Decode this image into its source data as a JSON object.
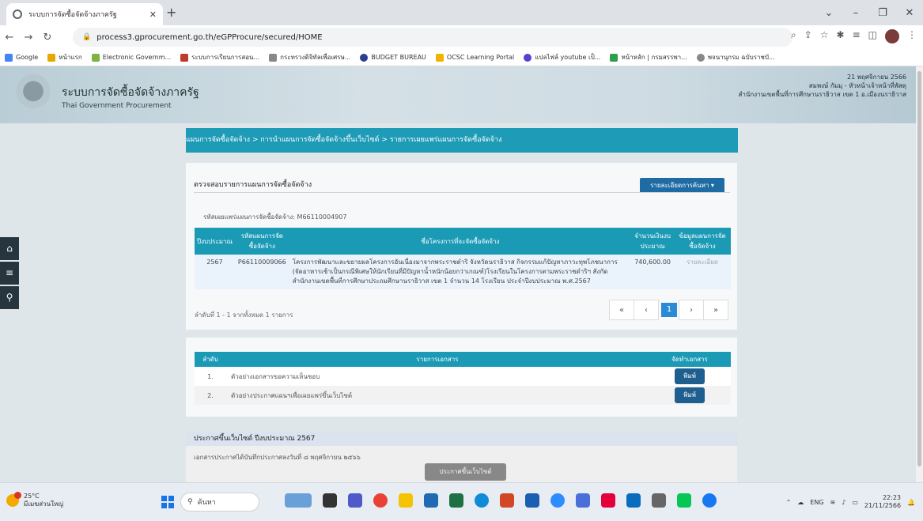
{
  "browser": {
    "tab_title": "ระบบการจัดซื้อจัดจ้างภาครัฐ",
    "url": "process3.gprocurement.go.th/eGPProcure/secured/HOME",
    "bookmarks": [
      "Google",
      "หน้าแรก",
      "Electronic Governm...",
      "ระบบการเรียนการสอน...",
      "กระทรวงดิจิทัลเพื่อเศรษ...",
      "BUDGET BUREAU",
      "OCSC Learning Portal",
      "แปลไฟล์ youtube เป็...",
      "หน้าหลัก | กรมสรรพา...",
      "พจนานุกรม ฉบับราชบั..."
    ]
  },
  "header": {
    "title": "ระบบการจัดซื้อจัดจ้างภาครัฐ",
    "subtitle": "Thai Government Procurement",
    "date": "21 พฤศจิกายน 2566",
    "user": "สมพงษ์ กัมมุ - หัวหน้าเจ้าหน้าที่พัสดุ",
    "org": "สำนักงานเขตพื้นที่การศึกษานราธิวาส เขต 1 อ.เมืองนราธิวาส"
  },
  "breadcrumb": "แผนการจัดซื้อจัดจ้าง > การนำแผนการจัดซื้อจัดจ้างขึ้นเว็บไซต์ > รายการเผยแพร่แผนการจัดซื้อจัดจ้าง",
  "check_panel": {
    "title": "ตรวจสอบรายการแผนการจัดซื้อจัดจ้าง",
    "detail_button": "รายละเอียดการค้นหา ▾",
    "plan_code_label": "รหัสเผยแพร่แผนการจัดซื้อจัดจ้าง: M66110004907",
    "columns": {
      "year": "ปีงบประมาณ",
      "plan_code": "รหัสแผนการจัดซื้อจัดจ้าง",
      "project_name": "ชื่อโครงการที่จะจัดซื้อจัดจ้าง",
      "budget": "จำนวนเงินงบประมาณ",
      "plan_info": "ข้อมูลแผนการจัดซื้อจัดจ้าง"
    },
    "row": {
      "year": "2567",
      "plan_code": "P66110009066",
      "project_name": "โครงการพัฒนาและขยายผลโครงการอันเนื่องมาจากพระราชดำริ จังหวัดนราธิวาส กิจกรรมแก้ปัญหาภาวะทุพโภชนาการ (จัดอาหารเช้าเป็นกรณีพิเศษให้นักเรียนที่มีปัญหาน้ำหนักน้อยกว่าเกณฑ์)โรงเรียนในโครงการตามพระราชดำริฯ สังกัดสำนักงานเขตพื้นที่การศึกษาประถมศึกษานราธิวาส เขต 1 จำนวน 14 โรงเรียน ประจำปีงบประมาณ พ.ศ.2567",
      "budget": "740,600.00",
      "plan_info": "รายละเอียด"
    },
    "order_text": "ลำดับที่ 1 - 1 จากทั้งหมด 1 รายการ",
    "pager": {
      "first": "«",
      "prev": "‹",
      "current": "1",
      "next": "›",
      "last": "»"
    }
  },
  "docs_panel": {
    "columns": {
      "no": "ลำดับ",
      "doc": "รายการเอกสาร",
      "action": "จัดทำเอกสาร"
    },
    "rows": [
      {
        "no": "1.",
        "doc": "ตัวอย่างเอกสารขอความเห็นชอบ",
        "action": "พิมพ์"
      },
      {
        "no": "2.",
        "doc": "ตัวอย่างประกาศแผนฯเพื่อเผยแพร่ขึ้นเว็บไซต์",
        "action": "พิมพ์"
      }
    ]
  },
  "announce_panel": {
    "title": "ประกาศขึ้นเว็บไซต์ ปีงบประมาณ 2567",
    "text": "เอกสารประกาศได้บันทึกประกาศลงวันที่ ๘ พฤศจิกายน ๒๕๖๖",
    "button": "ประกาศขึ้นเว็บไซต์"
  },
  "taskbar": {
    "temp": "25°C",
    "weather": "มีเมฆส่วนใหญ่",
    "search_placeholder": "ค้นหา",
    "lang": "ENG",
    "time": "22:23",
    "date": "21/11/2566"
  },
  "colors": {
    "teal": "#1e9bb6",
    "dark_blue": "#1f6ca5",
    "page_bg": "#dfe6ea"
  }
}
